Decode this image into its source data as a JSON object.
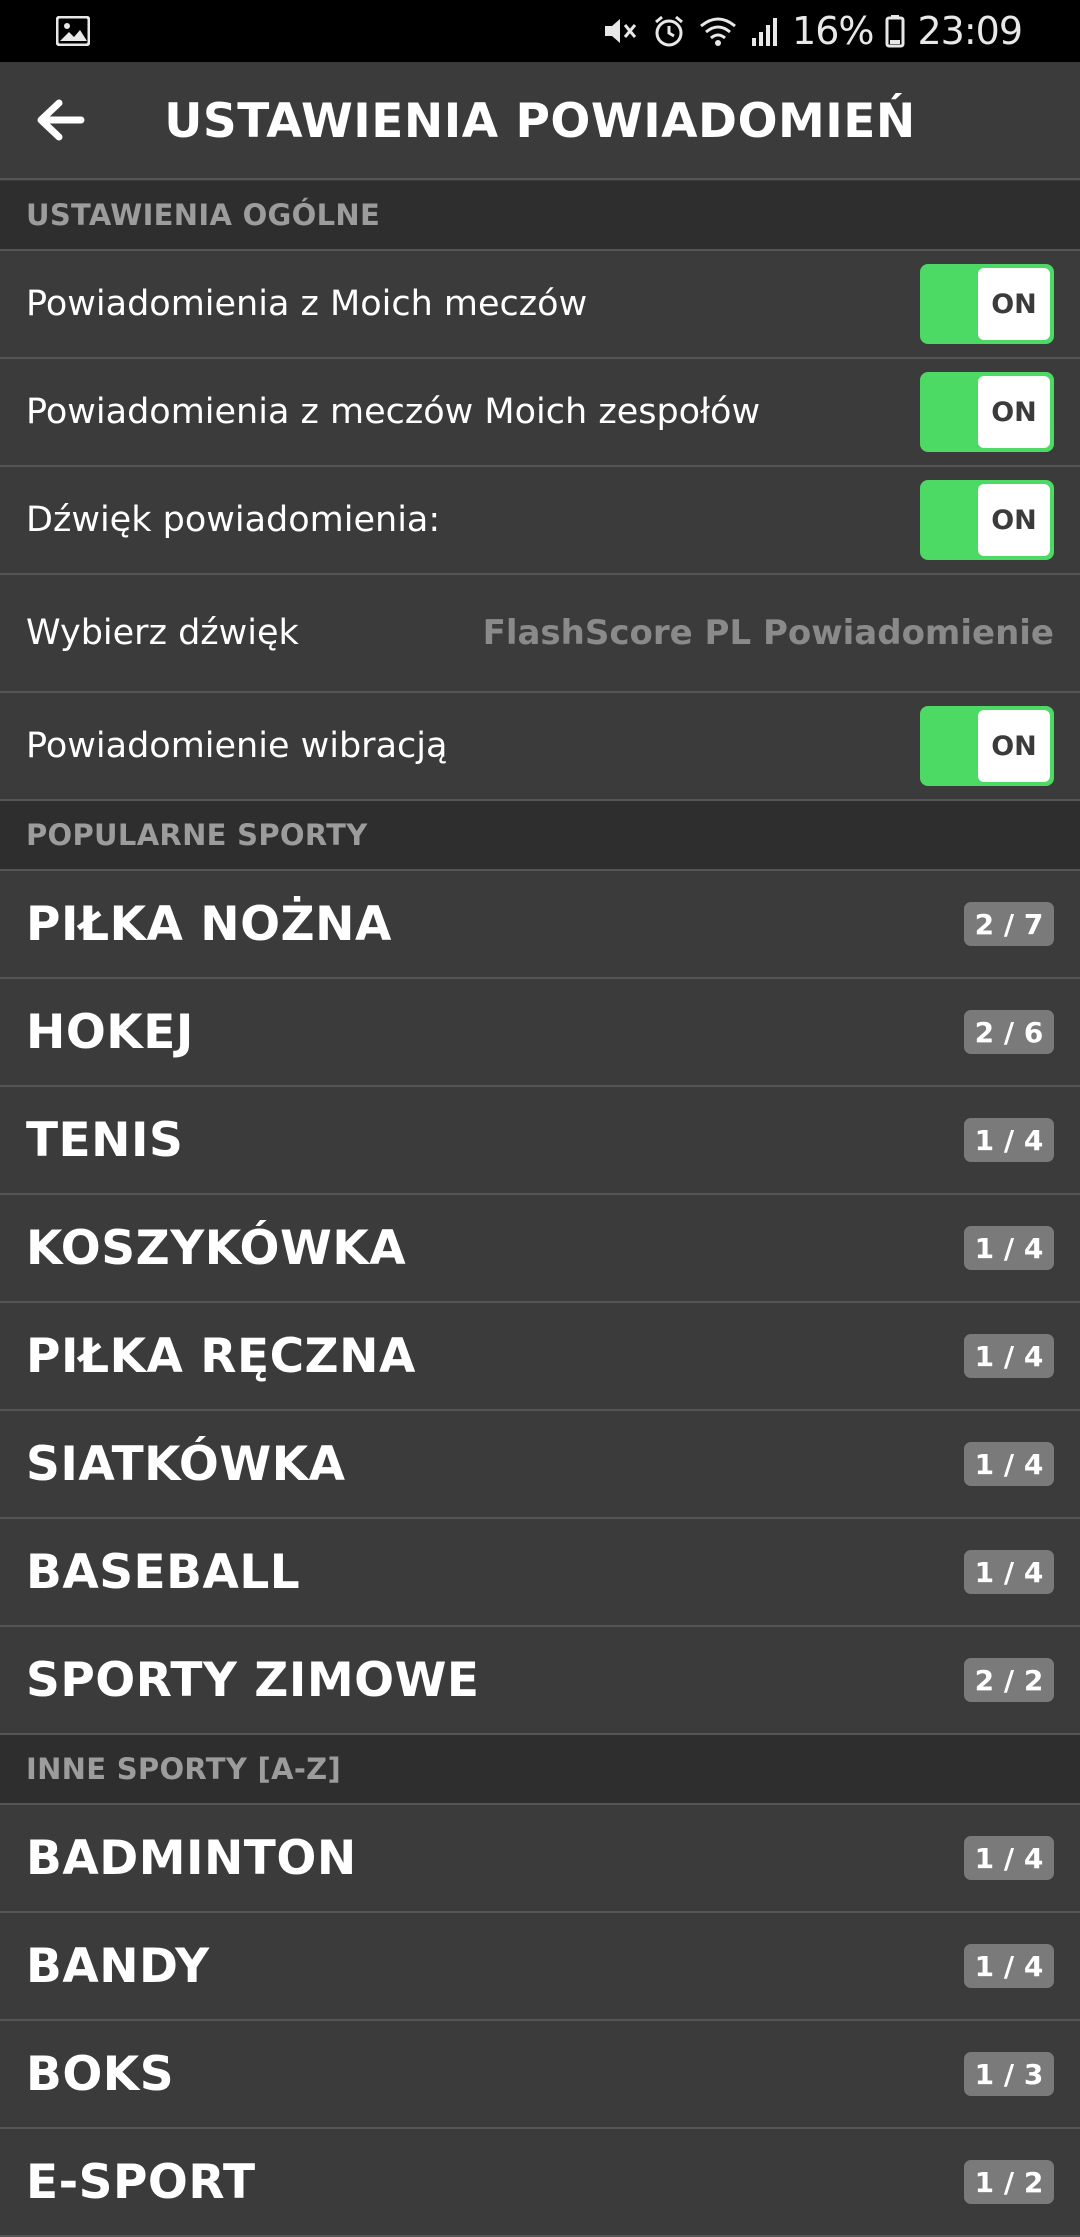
{
  "status_bar": {
    "battery": "16%",
    "time": "23:09"
  },
  "header": {
    "title": "USTAWIENIA POWIADOMIEŃ"
  },
  "general": {
    "section_title": "USTAWIENIA OGÓLNE",
    "my_matches_label": "Powiadomienia z Moich meczów",
    "my_matches_toggle": "ON",
    "my_teams_label": "Powiadomienia z meczów Moich zespołów",
    "my_teams_toggle": "ON",
    "sound_label": "Dźwięk powiadomienia:",
    "sound_toggle": "ON",
    "choose_sound_label": "Wybierz dźwięk",
    "choose_sound_value": "FlashScore PL Powiadomienie",
    "vibration_label": "Powiadomienie wibracją",
    "vibration_toggle": "ON"
  },
  "popular": {
    "section_title": "POPULARNE SPORTY",
    "items": [
      {
        "name": "PIŁKA NOŻNA",
        "count": "2 / 7"
      },
      {
        "name": "HOKEJ",
        "count": "2 / 6"
      },
      {
        "name": "TENIS",
        "count": "1 / 4"
      },
      {
        "name": "KOSZYKÓWKA",
        "count": "1 / 4"
      },
      {
        "name": "PIŁKA RĘCZNA",
        "count": "1 / 4"
      },
      {
        "name": "SIATKÓWKA",
        "count": "1 / 4"
      },
      {
        "name": "BASEBALL",
        "count": "1 / 4"
      },
      {
        "name": "SPORTY ZIMOWE",
        "count": "2 / 2"
      }
    ]
  },
  "other": {
    "section_title": "INNE SPORTY [A-Z]",
    "items": [
      {
        "name": "BADMINTON",
        "count": "1 / 4"
      },
      {
        "name": "BANDY",
        "count": "1 / 4"
      },
      {
        "name": "BOKS",
        "count": "1 / 3"
      },
      {
        "name": "E-SPORT",
        "count": "1 / 2"
      }
    ]
  },
  "colors": {
    "background": "#3b3b3b",
    "section_background": "#2e2e2e",
    "toggle_on": "#4cd964",
    "badge": "#7a7a7a"
  }
}
